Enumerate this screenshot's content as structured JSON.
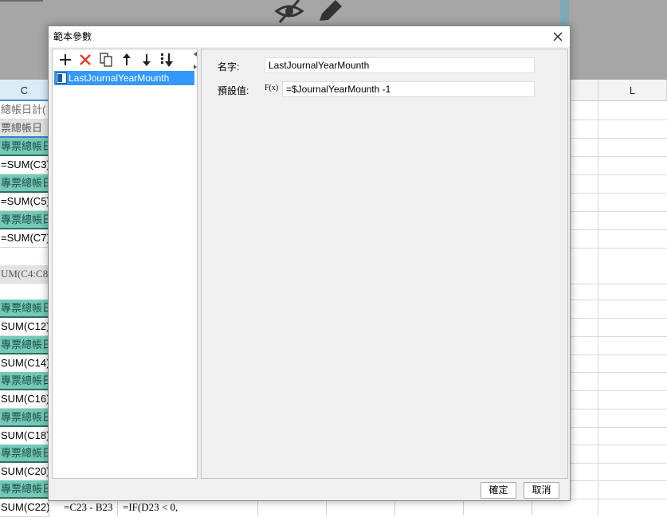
{
  "dialog": {
    "title": "範本參數",
    "toolbar": {
      "icons": [
        "plus-icon",
        "delete-x-icon",
        "copy-icon",
        "arrow-up-icon",
        "arrow-down-icon",
        "move-to-bottom-icon"
      ]
    },
    "parameters": [
      {
        "name": "LastJournalYearMounth"
      }
    ],
    "form": {
      "name_label": "名字:",
      "name_value": "LastJournalYearMounth",
      "default_label": "預設值:",
      "default_value": "=$JournalYearMounth -1",
      "fx_label": "F(x)"
    },
    "ok_label": "確定",
    "cancel_label": "取消"
  },
  "sheet": {
    "col_c": "C",
    "col_l": "L",
    "cells": [
      "總帳日計(",
      "票總帳日",
      "專票總帳日",
      "=SUM(C3)",
      "專票總帳日",
      "=SUM(C5)",
      "專票總帳日",
      "=SUM(C7)",
      "",
      "UM(C4:C8)",
      "",
      "專票總帳日",
      "SUM(C12)",
      "專票總帳日",
      "SUM(C14)",
      "專票總帳日",
      "SUM(C16)",
      "專票總帳日",
      "SUM(C18)",
      "專票總帳日",
      "SUM(C20)",
      "專票總帳日",
      "SUM(C22)"
    ],
    "formula_b": "=C23 - B23",
    "formula_d": "=IF(D23 < 0,"
  },
  "colors": {
    "teal_cell": "#73cbb7",
    "selection": "#3399ff"
  }
}
